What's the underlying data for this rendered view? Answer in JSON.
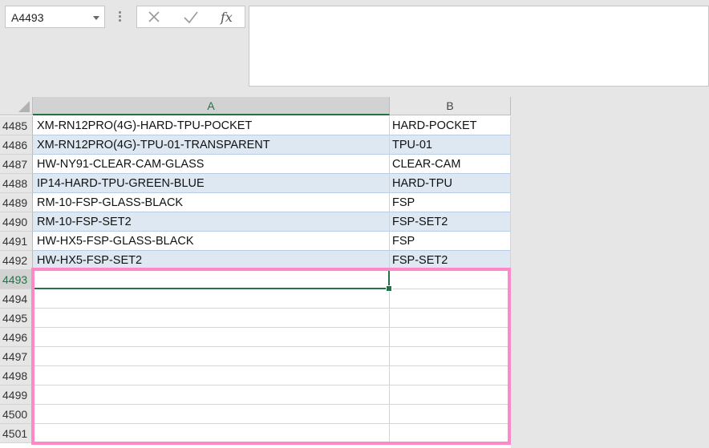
{
  "name_box": {
    "value": "A4493"
  },
  "formula_bar": {
    "cancel_icon": "close-icon",
    "enter_icon": "check-icon",
    "fx_label": "fx",
    "content": ""
  },
  "columns": [
    {
      "label": "A"
    },
    {
      "label": "B"
    }
  ],
  "rows": [
    {
      "num": "4485",
      "a": "XM-RN12PRO(4G)-HARD-TPU-POCKET",
      "b": "HARD-POCKET"
    },
    {
      "num": "4486",
      "a": "XM-RN12PRO(4G)-TPU-01-TRANSPARENT",
      "b": "TPU-01"
    },
    {
      "num": "4487",
      "a": "HW-NY91-CLEAR-CAM-GLASS",
      "b": "CLEAR-CAM"
    },
    {
      "num": "4488",
      "a": "IP14-HARD-TPU-GREEN-BLUE",
      "b": "HARD-TPU"
    },
    {
      "num": "4489",
      "a": "RM-10-FSP-GLASS-BLACK",
      "b": "FSP"
    },
    {
      "num": "4490",
      "a": "RM-10-FSP-SET2",
      "b": "FSP-SET2"
    },
    {
      "num": "4491",
      "a": "HW-HX5-FSP-GLASS-BLACK",
      "b": "FSP"
    },
    {
      "num": "4492",
      "a": "HW-HX5-FSP-SET2",
      "b": "FSP-SET2"
    },
    {
      "num": "4493",
      "a": "",
      "b": ""
    },
    {
      "num": "4494",
      "a": "",
      "b": ""
    },
    {
      "num": "4495",
      "a": "",
      "b": ""
    },
    {
      "num": "4496",
      "a": "",
      "b": ""
    },
    {
      "num": "4497",
      "a": "",
      "b": ""
    },
    {
      "num": "4498",
      "a": "",
      "b": ""
    },
    {
      "num": "4499",
      "a": "",
      "b": ""
    },
    {
      "num": "4500",
      "a": "",
      "b": ""
    },
    {
      "num": "4501",
      "a": "",
      "b": ""
    }
  ],
  "colors": {
    "accent": "#217346",
    "band": "#dde8f3",
    "highlight_box": "#ff88c8"
  }
}
